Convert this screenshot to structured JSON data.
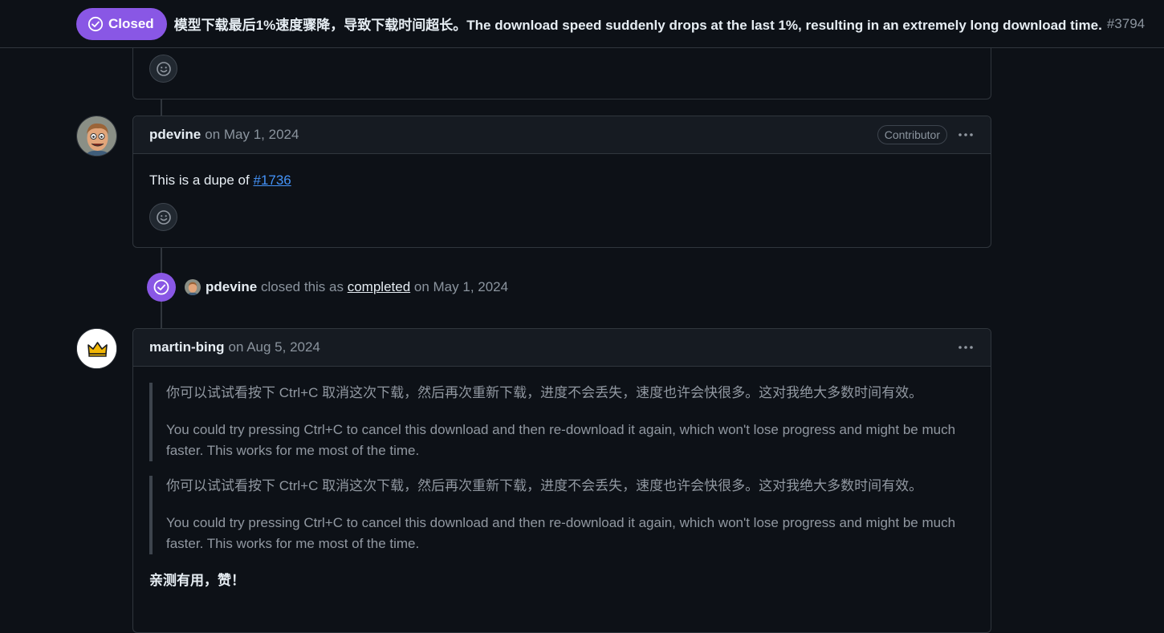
{
  "issue": {
    "state": "Closed",
    "title": "模型下载最后1%速度骤降，导致下载时间超长。The download speed suddenly drops at the last 1%, resulting in an extremely long download time.",
    "number": "#3794"
  },
  "comments": [
    {
      "author": "pdevine",
      "date": "on May 1, 2024",
      "role": "Contributor",
      "body_prefix": "This is a dupe of ",
      "body_link": "#1736"
    },
    {
      "author": "martin-bing",
      "date": "on Aug 5, 2024",
      "quotes": [
        {
          "zh": "你可以试试看按下 Ctrl+C 取消这次下载，然后再次重新下载，进度不会丢失，速度也许会快很多。这对我绝大多数时间有效。",
          "en": "You could try pressing Ctrl+C to cancel this download and then re-download it again, which won't lose progress and might be much faster. This works for me most of the time."
        },
        {
          "zh": "你可以试试看按下 Ctrl+C 取消这次下载，然后再次重新下载，进度不会丢失，速度也许会快很多。这对我绝大多数时间有效。",
          "en": "You could try pressing Ctrl+C to cancel this download and then re-download it again, which won't lose progress and might be much faster. This works for me most of the time."
        }
      ],
      "reply": "亲测有用，赞！"
    }
  ],
  "event": {
    "actor": "pdevine",
    "text_before": "closed this as",
    "link": "completed",
    "text_after": "on May 1, 2024"
  },
  "icons": {
    "state": "check-circle-icon",
    "reaction": "smiley-icon",
    "menu": "kebab-horizontal-icon",
    "crown": "crown-icon"
  },
  "colors": {
    "closed_purple": "#8957e5",
    "link_blue": "#4493f8",
    "background": "#0d1117"
  }
}
